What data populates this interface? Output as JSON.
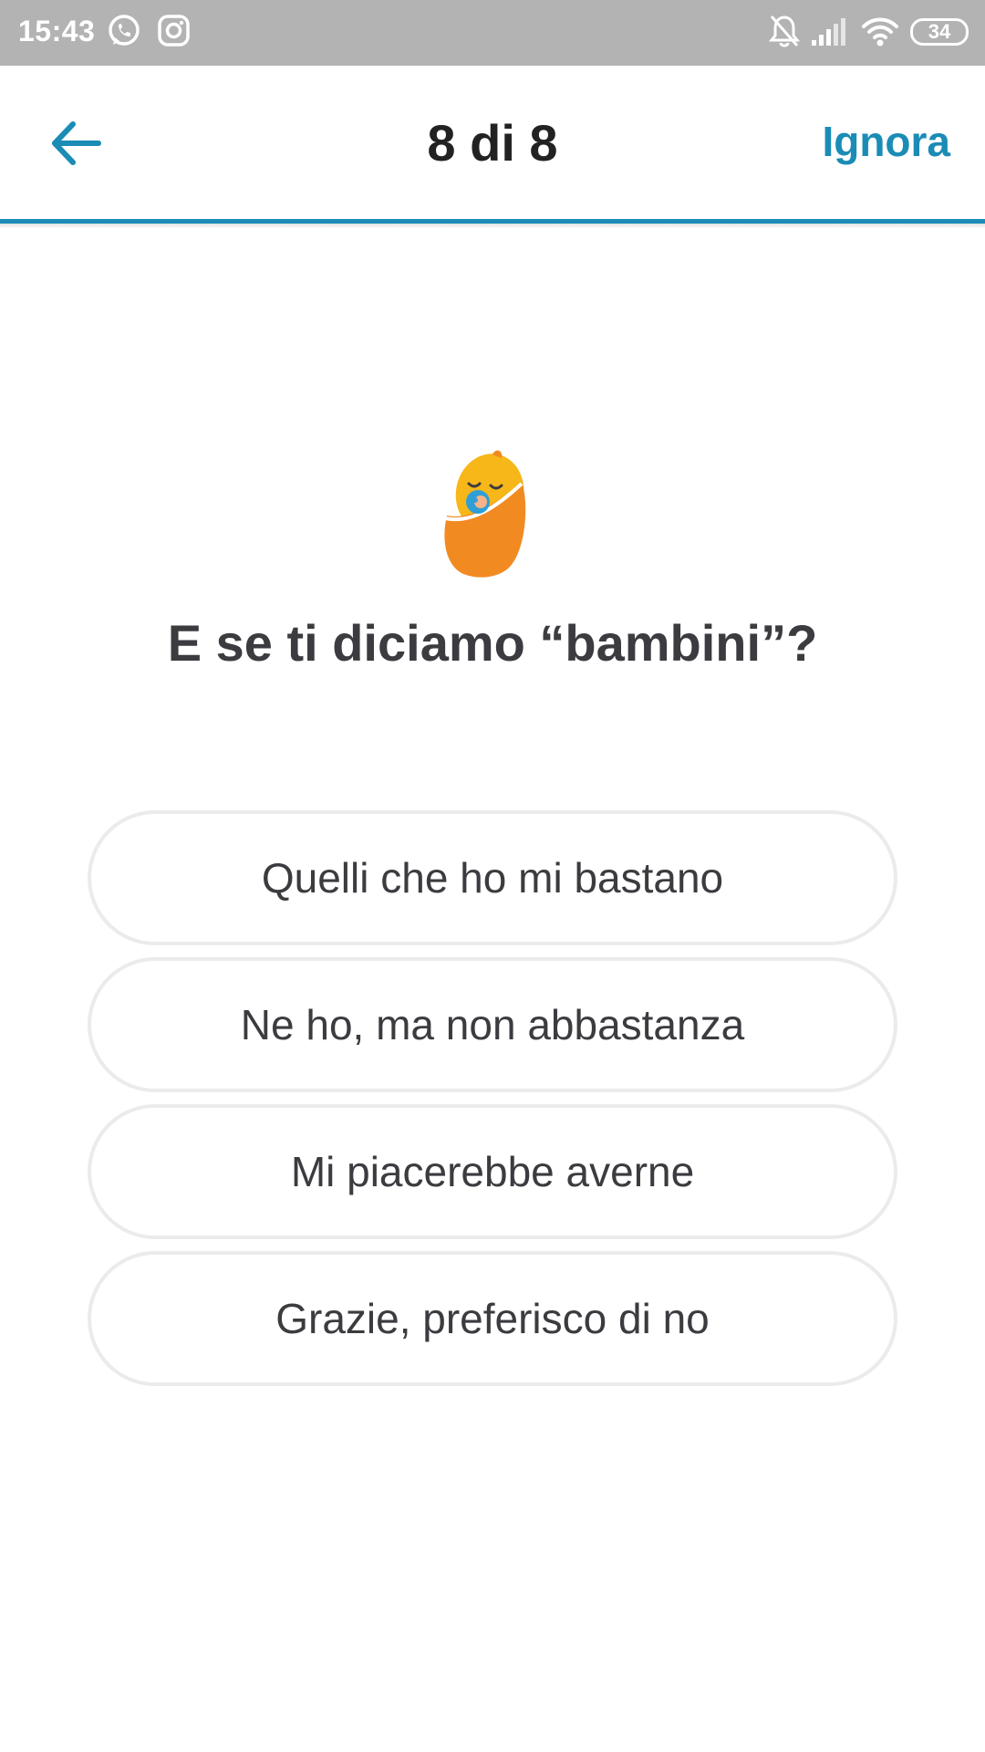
{
  "status_bar": {
    "time": "15:43",
    "battery": "34",
    "notification_icons": [
      "whatsapp-icon",
      "instagram-icon"
    ],
    "system_icons": [
      "bell-muted-icon",
      "signal-icon",
      "wifi-icon",
      "battery-icon"
    ]
  },
  "header": {
    "back_icon": "arrow-left-icon",
    "counter": "8 di 8",
    "skip_label": "Ignora"
  },
  "question": {
    "illustration": "swaddled-baby-icon",
    "text": "E se ti diciamo “bambini”?"
  },
  "options": [
    {
      "label": "Quelli che ho mi bastano"
    },
    {
      "label": "Ne ho, ma non abbastanza"
    },
    {
      "label": "Mi piacerebbe averne"
    },
    {
      "label": "Grazie, preferisco di no"
    }
  ],
  "colors": {
    "accent": "#1a8cb5",
    "status_bar": "#b3b3b3",
    "text_dark": "#3b3b40",
    "option_border": "#ebebee",
    "baby_orange": "#f28a22",
    "baby_yellow": "#f7b719"
  }
}
